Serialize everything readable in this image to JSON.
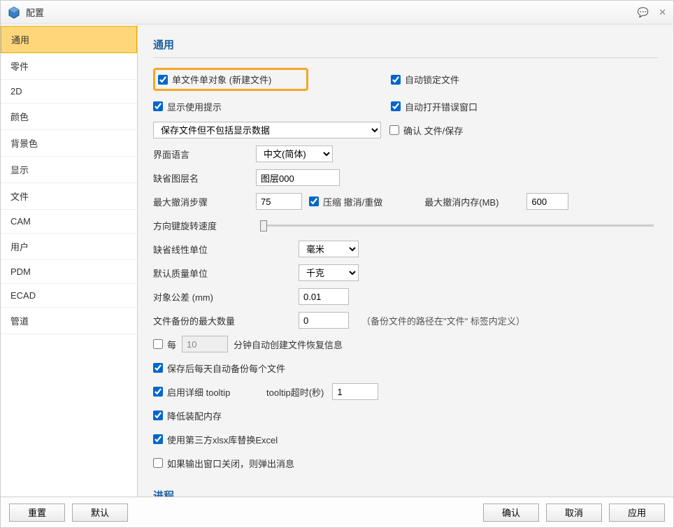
{
  "window": {
    "title": "配置"
  },
  "sidebar": {
    "items": [
      {
        "label": "通用"
      },
      {
        "label": "零件"
      },
      {
        "label": "2D"
      },
      {
        "label": "颜色"
      },
      {
        "label": "背景色"
      },
      {
        "label": "显示"
      },
      {
        "label": "文件"
      },
      {
        "label": "CAM"
      },
      {
        "label": "用户"
      },
      {
        "label": "PDM"
      },
      {
        "label": "ECAD"
      },
      {
        "label": "管道"
      }
    ],
    "active_index": 0
  },
  "general": {
    "heading": "通用",
    "single_file_single_object": {
      "label": "单文件单对象 (新建文件)",
      "checked": true
    },
    "auto_lock_file": {
      "label": "自动锁定文件",
      "checked": true
    },
    "show_usage_tips": {
      "label": "显示使用提示",
      "checked": true
    },
    "auto_open_error_window": {
      "label": "自动打开错误窗口",
      "checked": true
    },
    "save_file_dropdown": {
      "value": "保存文件但不包括显示数据"
    },
    "confirm_file_save": {
      "label": "确认 文件/保存",
      "checked": false
    },
    "ui_language": {
      "label": "界面语言",
      "value": "中文(简体)"
    },
    "default_layer_name": {
      "label": "缺省图层名",
      "value": "图层000"
    },
    "max_undo_steps": {
      "label": "最大撤消步骤",
      "value": "75"
    },
    "compress_undo_redo": {
      "label": "压缩 撤消/重做",
      "checked": true
    },
    "max_undo_memory": {
      "label": "最大撤消内存(MB)",
      "value": "600"
    },
    "arrow_key_rotation_speed": {
      "label": "方向键旋转速度"
    },
    "default_linear_unit": {
      "label": "缺省线性单位",
      "value": "毫米"
    },
    "default_mass_unit": {
      "label": "默认质量单位",
      "value": "千克"
    },
    "object_tolerance": {
      "label": "对象公差   (mm)",
      "value": "0.01"
    },
    "max_file_backups": {
      "label": "文件备份的最大数量",
      "value": "0",
      "note": "（备份文件的路径在\"文件\" 标签内定义）"
    },
    "auto_recovery": {
      "prefix_label": "每",
      "value": "10",
      "suffix_label": "分钟自动创建文件恢复信息",
      "checked": false
    },
    "backup_each_file_daily": {
      "label": "保存后每天自动备份每个文件",
      "checked": true
    },
    "enable_detailed_tooltip": {
      "label": "启用详细 tooltip",
      "checked": true
    },
    "tooltip_timeout": {
      "label": "tooltip超时(秒)",
      "value": "1"
    },
    "reduce_assembly_memory": {
      "label": "降低装配内存",
      "checked": true
    },
    "use_third_party_xlsx": {
      "label": "使用第三方xlsx库替换Excel",
      "checked": true
    },
    "popup_if_output_closed": {
      "label": "如果输出窗口关闭，则弹出消息",
      "checked": false
    }
  },
  "process": {
    "heading": "进程"
  },
  "footer": {
    "reset": "重置",
    "default": "默认",
    "ok": "确认",
    "cancel": "取消",
    "apply": "应用"
  }
}
